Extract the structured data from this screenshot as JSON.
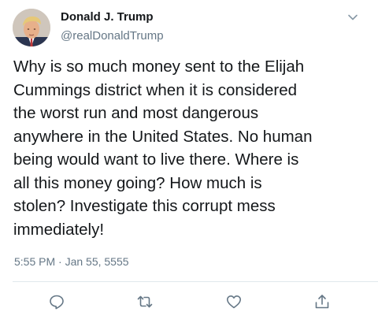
{
  "tweet": {
    "author": {
      "display_name": "Donald J. Trump",
      "handle": "@realDonaldTrump"
    },
    "text": "Why is so much money sent to the Elijah\nCummings district when it is considered\nthe worst run and most dangerous\nanywhere in the United States. No human\nbeing would want to live there. Where is\nall this money going? How much is\nstolen? Investigate this corrupt mess\nimmediately!",
    "timestamp": "5:55 PM · Jan 55, 5555",
    "actions": [
      {
        "name": "reply",
        "icon": "reply-icon"
      },
      {
        "name": "retweet",
        "icon": "retweet-icon"
      },
      {
        "name": "like",
        "icon": "heart-icon"
      },
      {
        "name": "share",
        "icon": "share-icon"
      }
    ],
    "colors": {
      "text": "#14171a",
      "secondary": "#657786",
      "divider": "#e1e8ed"
    }
  }
}
